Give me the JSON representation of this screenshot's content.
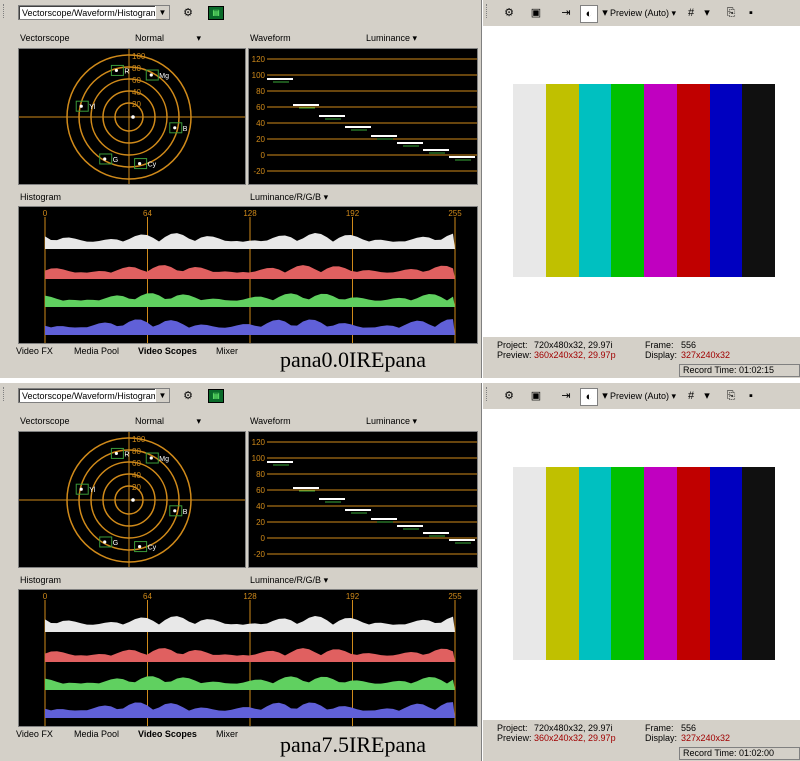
{
  "panels": [
    {
      "scope_select": "Vectorscope/Waveform/Histogram",
      "vectorscope": {
        "label": "Vectorscope",
        "mode": "Normal",
        "rings": [
          "100",
          "80",
          "60",
          "40",
          "20"
        ],
        "targets": [
          "R",
          "Mg",
          "B",
          "Cy",
          "G",
          "Yl"
        ]
      },
      "waveform": {
        "label": "Waveform",
        "mode": "Luminance",
        "levels": [
          "120",
          "100",
          "80",
          "60",
          "40",
          "20",
          "0",
          "-20"
        ]
      },
      "histogram": {
        "label": "Histogram",
        "mode": "Luminance/R/G/B",
        "ticks": [
          "0",
          "64",
          "128",
          "192",
          "255"
        ]
      },
      "tabs": [
        "Video FX",
        "Media Pool",
        "Video Scopes",
        "Mixer"
      ],
      "caption": "pana0.0IREpana",
      "preview": {
        "mode": "Preview (Auto)",
        "project_label": "Project:",
        "project_value": "720x480x32, 29.97i",
        "preview_label": "Preview:",
        "preview_value": "360x240x32, 29.97p",
        "frame_label": "Frame:",
        "frame_value": "556",
        "display_label": "Display:",
        "display_value": "327x240x32",
        "record_time": "Record Time: 01:02:15"
      }
    },
    {
      "scope_select": "Vectorscope/Waveform/Histogram",
      "vectorscope": {
        "label": "Vectorscope",
        "mode": "Normal",
        "rings": [
          "100",
          "80",
          "60",
          "40",
          "20"
        ],
        "targets": [
          "R",
          "Mg",
          "B",
          "Cy",
          "G",
          "Yl"
        ]
      },
      "waveform": {
        "label": "Waveform",
        "mode": "Luminance",
        "levels": [
          "120",
          "100",
          "80",
          "60",
          "40",
          "20",
          "0",
          "-20"
        ]
      },
      "histogram": {
        "label": "Histogram",
        "mode": "Luminance/R/G/B",
        "ticks": [
          "0",
          "64",
          "128",
          "192",
          "255"
        ]
      },
      "tabs": [
        "Video FX",
        "Media Pool",
        "Video Scopes",
        "Mixer"
      ],
      "caption": "pana7.5IREpana",
      "preview": {
        "mode": "Preview (Auto)",
        "project_label": "Project:",
        "project_value": "720x480x32, 29.97i",
        "preview_label": "Preview:",
        "preview_value": "360x240x32, 29.97p",
        "frame_label": "Frame:",
        "frame_value": "556",
        "display_label": "Display:",
        "display_value": "327x240x32",
        "record_time": "Record Time: 01:02:00"
      }
    }
  ],
  "color_bars": [
    "#e8e8e8",
    "#c0c000",
    "#00c0c0",
    "#00c000",
    "#c000c0",
    "#c00000",
    "#0000c0",
    "#101010"
  ],
  "colors": {
    "scope_bg": "#000000",
    "graticule": "#d08a1a",
    "luma": "#e8e8e8",
    "red": "#e06060",
    "green": "#60d060",
    "blue": "#6060d8",
    "warn_text": "#a00000"
  }
}
